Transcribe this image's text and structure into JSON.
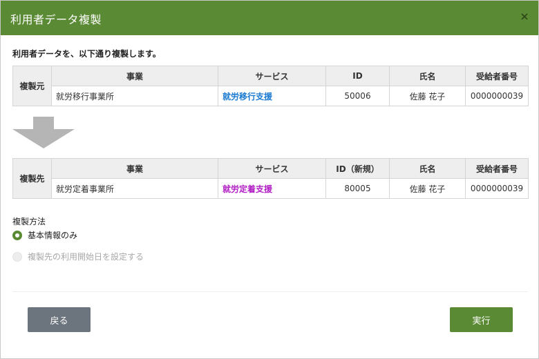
{
  "dialog": {
    "title": "利用者データ複製",
    "close_icon": "close-icon",
    "instruction": "利用者データを、以下通り複製します。"
  },
  "colors": {
    "accent": "#5a8a33",
    "back_button": "#6c757d",
    "source_service": "#1a7ad0",
    "target_service": "#b01cc4"
  },
  "source": {
    "row_label": "複製元",
    "headers": [
      "事業",
      "サービス",
      "ID",
      "氏名",
      "受給者番号"
    ],
    "row": {
      "business": "就労移行事業所",
      "service": "就労移行支援",
      "id": "50006",
      "name": "佐藤 花子",
      "recipient_no": "0000000039"
    }
  },
  "target": {
    "row_label": "複製先",
    "headers": [
      "事業",
      "サービス",
      "ID（新規）",
      "氏名",
      "受給者番号"
    ],
    "row": {
      "business": "就労定着事業所",
      "service": "就労定着支援",
      "id": "80005",
      "name": "佐藤 花子",
      "recipient_no": "0000000039"
    }
  },
  "arrow_icon": "arrow-down-icon",
  "method": {
    "label": "複製方法",
    "options": [
      {
        "label": "基本情報のみ",
        "selected": true,
        "enabled": true
      },
      {
        "label": "複製先の利用開始日を設定する",
        "selected": false,
        "enabled": false
      }
    ]
  },
  "buttons": {
    "back": "戻る",
    "run": "実行"
  }
}
